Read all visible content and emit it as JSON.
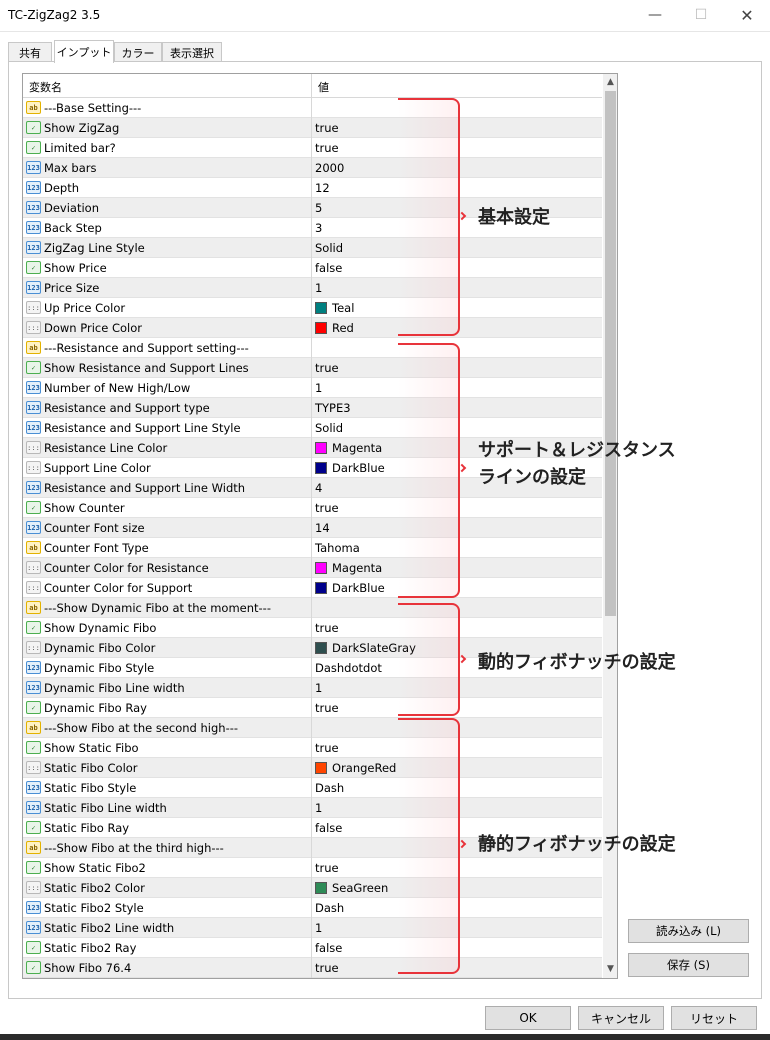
{
  "window": {
    "title": "TC-ZigZag2 3.5"
  },
  "tabs": [
    {
      "label": "共有",
      "active": false
    },
    {
      "label": "インプット",
      "active": true
    },
    {
      "label": "カラー",
      "active": false
    },
    {
      "label": "表示選択",
      "active": false
    }
  ],
  "grid": {
    "col_variable": "変数名",
    "col_value": "値",
    "rows": [
      {
        "type": "str",
        "name": "---Base Setting---",
        "value": ""
      },
      {
        "type": "bool",
        "name": "Show ZigZag",
        "value": "true"
      },
      {
        "type": "bool",
        "name": "Limited bar?",
        "value": "true"
      },
      {
        "type": "num",
        "name": "Max bars",
        "value": "2000"
      },
      {
        "type": "num",
        "name": "Depth",
        "value": "12"
      },
      {
        "type": "num",
        "name": "Deviation",
        "value": "5"
      },
      {
        "type": "num",
        "name": "Back Step",
        "value": "3"
      },
      {
        "type": "num",
        "name": "ZigZag Line Style",
        "value": "Solid"
      },
      {
        "type": "bool",
        "name": "Show Price",
        "value": "false"
      },
      {
        "type": "num",
        "name": "Price Size",
        "value": "1"
      },
      {
        "type": "col",
        "name": "Up Price Color",
        "value": "Teal",
        "color": "#008080"
      },
      {
        "type": "col",
        "name": "Down Price Color",
        "value": "Red",
        "color": "#ff0000"
      },
      {
        "type": "str",
        "name": "---Resistance and Support setting---",
        "value": ""
      },
      {
        "type": "bool",
        "name": "Show Resistance and Support Lines",
        "value": "true"
      },
      {
        "type": "num",
        "name": "Number of New High/Low",
        "value": "1"
      },
      {
        "type": "num",
        "name": "Resistance and Support type",
        "value": "TYPE3"
      },
      {
        "type": "num",
        "name": "Resistance and Support Line Style",
        "value": "Solid"
      },
      {
        "type": "col",
        "name": "Resistance Line Color",
        "value": "Magenta",
        "color": "#ff00ff"
      },
      {
        "type": "col",
        "name": "Support Line Color",
        "value": "DarkBlue",
        "color": "#00008b"
      },
      {
        "type": "num",
        "name": "Resistance and Support Line Width",
        "value": "4"
      },
      {
        "type": "bool",
        "name": "Show Counter",
        "value": "true"
      },
      {
        "type": "num",
        "name": "Counter Font size",
        "value": "14"
      },
      {
        "type": "str",
        "name": "Counter Font Type",
        "value": "Tahoma"
      },
      {
        "type": "col",
        "name": "Counter Color for Resistance",
        "value": "Magenta",
        "color": "#ff00ff"
      },
      {
        "type": "col",
        "name": "Counter Color for Support",
        "value": "DarkBlue",
        "color": "#00008b"
      },
      {
        "type": "str",
        "name": "---Show Dynamic Fibo at the moment---",
        "value": ""
      },
      {
        "type": "bool",
        "name": "Show Dynamic Fibo",
        "value": "true"
      },
      {
        "type": "col",
        "name": "Dynamic Fibo Color",
        "value": "DarkSlateGray",
        "color": "#2f4f4f"
      },
      {
        "type": "num",
        "name": "Dynamic Fibo Style",
        "value": "Dashdotdot"
      },
      {
        "type": "num",
        "name": "Dynamic Fibo Line width",
        "value": "1"
      },
      {
        "type": "bool",
        "name": "Dynamic Fibo Ray",
        "value": "true"
      },
      {
        "type": "str",
        "name": "---Show Fibo at the second high---",
        "value": ""
      },
      {
        "type": "bool",
        "name": "Show Static Fibo",
        "value": "true"
      },
      {
        "type": "col",
        "name": "Static Fibo Color",
        "value": "OrangeRed",
        "color": "#ff4500"
      },
      {
        "type": "num",
        "name": "Static Fibo Style",
        "value": "Dash"
      },
      {
        "type": "num",
        "name": "Static Fibo Line width",
        "value": "1"
      },
      {
        "type": "bool",
        "name": "Static Fibo Ray",
        "value": "false"
      },
      {
        "type": "str",
        "name": "---Show Fibo at the third high---",
        "value": ""
      },
      {
        "type": "bool",
        "name": "Show Static Fibo2",
        "value": "true"
      },
      {
        "type": "col",
        "name": "Static Fibo2 Color",
        "value": "SeaGreen",
        "color": "#2e8b57"
      },
      {
        "type": "num",
        "name": "Static Fibo2 Style",
        "value": "Dash"
      },
      {
        "type": "num",
        "name": "Static Fibo2 Line width",
        "value": "1"
      },
      {
        "type": "bool",
        "name": "Static Fibo2 Ray",
        "value": "false"
      },
      {
        "type": "bool",
        "name": "Show Fibo 76.4",
        "value": "true"
      }
    ]
  },
  "annotations": {
    "basic": "基本設定",
    "sr_line1": "サポート＆レジスタンス",
    "sr_line2": "ラインの設定",
    "dynamic": "動的フィボナッチの設定",
    "static": "静的フィボナッチの設定",
    "color": "#e8333a"
  },
  "buttons": {
    "load": "読み込み (L)",
    "save": "保存 (S)",
    "ok": "OK",
    "cancel": "キャンセル",
    "reset": "リセット"
  },
  "icons": {
    "bool": "ab-icon-bool",
    "num": "123",
    "str": "ab",
    "col": "color-icon"
  }
}
